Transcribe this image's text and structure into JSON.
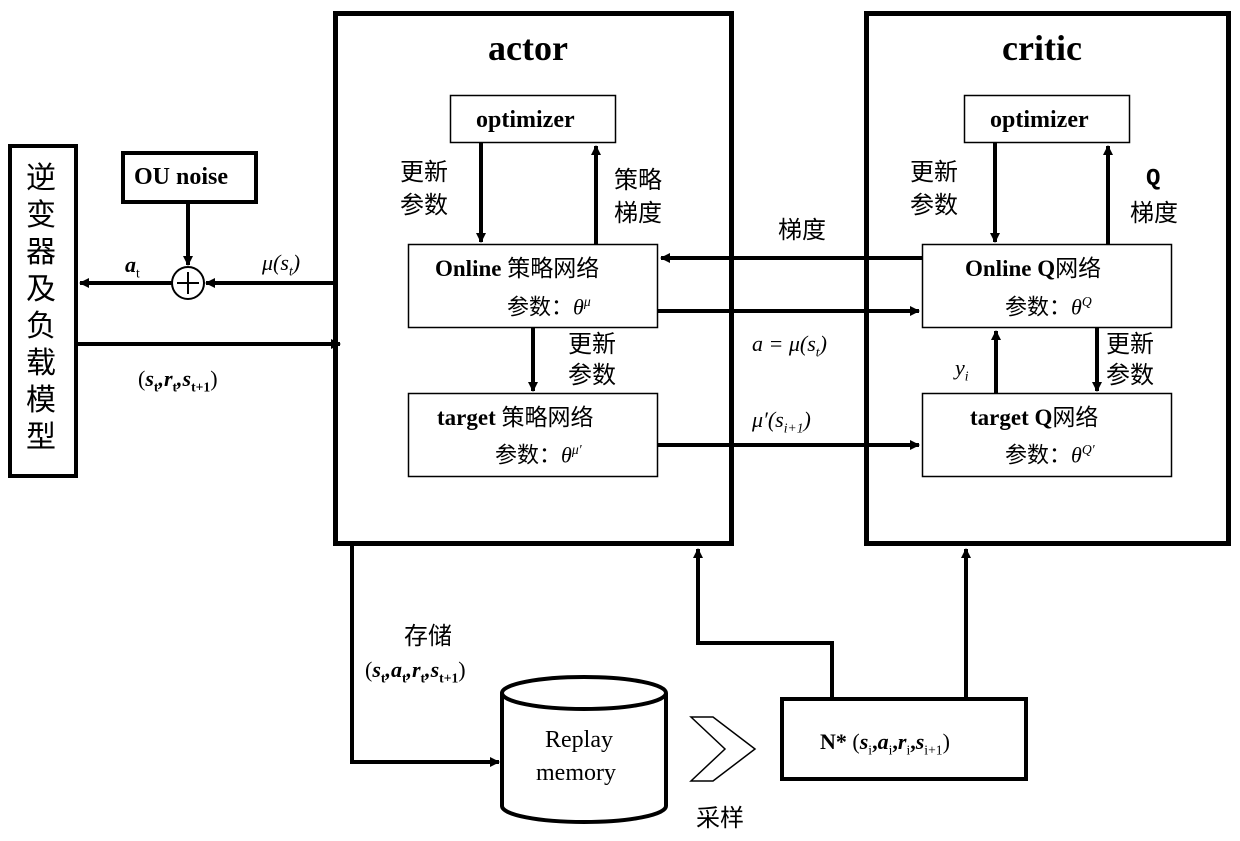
{
  "actor": {
    "title": "actor",
    "optimizer": "optimizer",
    "update_params_label": [
      "更新",
      "参数"
    ],
    "policy_gradient_label": [
      "策略",
      "梯度"
    ],
    "online_net": {
      "name_en": "Online",
      "name_cn": "策略网络",
      "param_label": "参数：",
      "param_symbol": "θ",
      "param_sup": "μ"
    },
    "target_net": {
      "name_en": "target",
      "name_cn": "策略网络",
      "param_label": "参数：",
      "param_symbol": "θ",
      "param_sup": "μ′"
    },
    "soft_update_label": [
      "更新",
      "参数"
    ]
  },
  "critic": {
    "title": "critic",
    "optimizer": "optimizer",
    "update_params_label": [
      "更新",
      "参数"
    ],
    "q_gradient_label": [
      "Q",
      "梯度"
    ],
    "online_net": {
      "name_en": "Online Q",
      "name_cn": "网络",
      "param_label": "参数：",
      "param_symbol": "θ",
      "param_sup": "Q"
    },
    "target_net": {
      "name_en": "target Q",
      "name_cn": "网络",
      "param_label": "参数：",
      "param_symbol": "θ",
      "param_sup": "Q′"
    },
    "soft_update_label": [
      "更新",
      "参数"
    ],
    "yi_label": {
      "base": "y",
      "sub": "i"
    }
  },
  "environment": {
    "label_chars": [
      "逆",
      "变",
      "器",
      "及",
      "负",
      "载",
      "模",
      "型"
    ]
  },
  "noise": {
    "label": "OU noise"
  },
  "signals": {
    "at": {
      "base": "a",
      "sub": "t"
    },
    "mu_st": {
      "text": "μ(s",
      "sub": "t",
      "close": ")"
    },
    "transition": {
      "text": "(s",
      "parts": [
        "t",
        ",r",
        "t",
        ",s",
        "t+1",
        ")"
      ]
    },
    "gradient_label": "梯度",
    "a_eq_mu": {
      "text": "a = μ(s",
      "sub": "t",
      "close": ")"
    },
    "mu_prime": {
      "text": "μ′(s",
      "sub": "i+1",
      "close": ")"
    }
  },
  "replay": {
    "store_label": "存储",
    "store_tuple": {
      "s": "s",
      "a": "a",
      "r": "r",
      "sub_t": "t",
      "sub_t1": "t+1"
    },
    "memory_label": [
      "Replay",
      "memory"
    ],
    "sample_label": "采样",
    "minibatch": {
      "prefix": "N*",
      "sub_i": "i",
      "sub_i1": "i+1"
    }
  }
}
